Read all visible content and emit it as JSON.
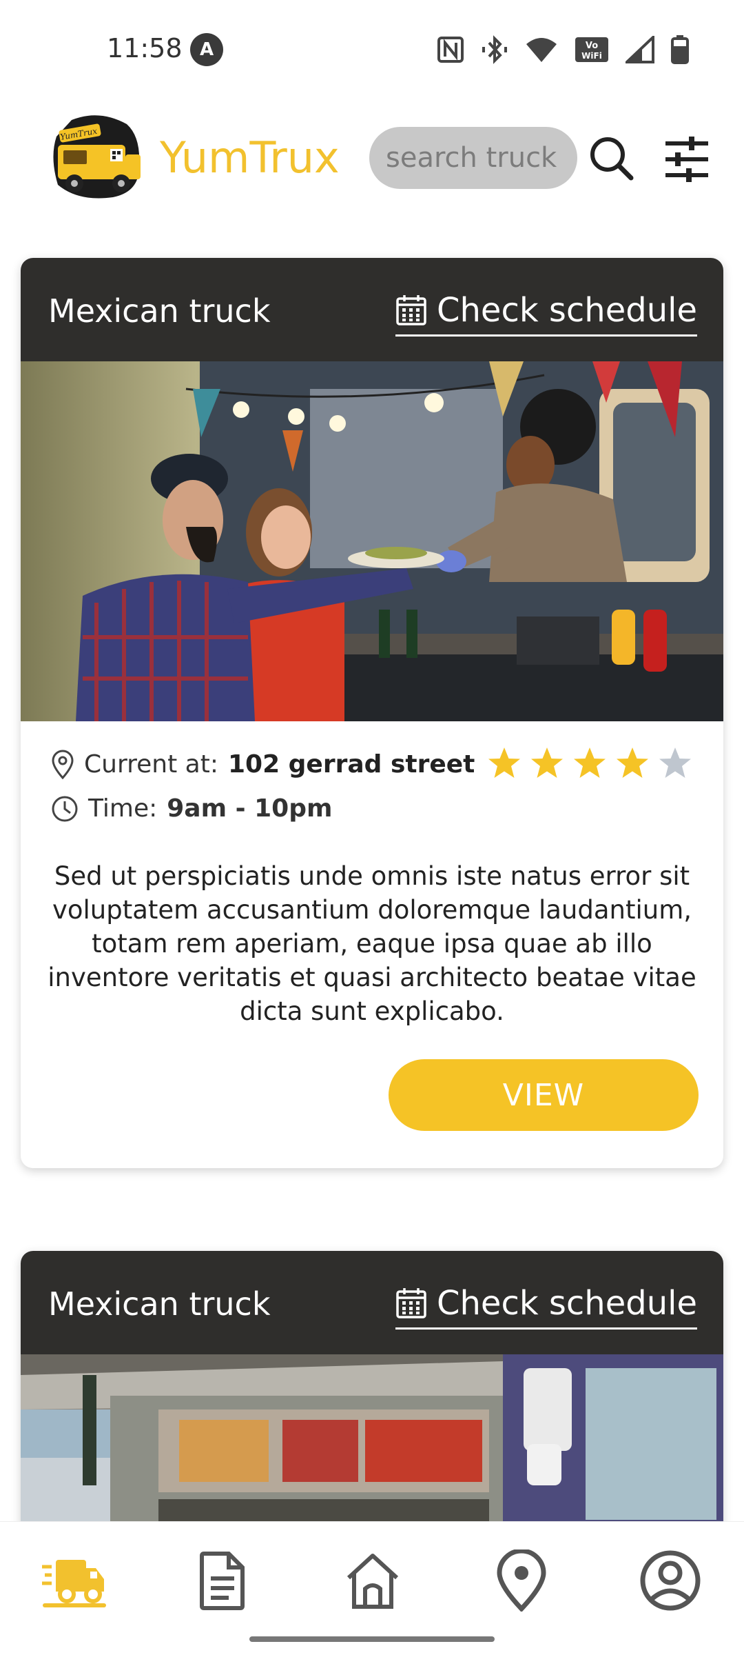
{
  "status_bar": {
    "time": "11:58",
    "badge": "A",
    "icons": [
      "nfc-icon",
      "bluetooth-vibrate-icon",
      "wifi-icon",
      "vowifi-icon",
      "cell-signal-icon",
      "battery-icon"
    ],
    "vowifi_label": "VoWiFi"
  },
  "header": {
    "brand": "YumTrux",
    "logo_text": "YumTrux",
    "search_placeholder": "search truck",
    "accent_color": "#F2C12E"
  },
  "cards": [
    {
      "title": "Mexican truck",
      "schedule_label": "Check schedule",
      "location_label": "Current at:",
      "location_value": "102 gerrad street",
      "time_label": "Time:",
      "time_value": "9am - 10pm",
      "rating": 4,
      "rating_max": 5,
      "description": "Sed ut perspiciatis unde omnis iste natus error sit voluptatem accusantium doloremque laudantium, totam rem aperiam, eaque ipsa quae ab illo inventore veritatis et quasi architecto beatae vitae dicta sunt explicabo.",
      "view_label": "VIEW"
    },
    {
      "title": "Mexican truck",
      "schedule_label": "Check schedule"
    }
  ],
  "bottom_nav": {
    "items": [
      "truck-icon",
      "document-icon",
      "home-icon",
      "location-pin-icon",
      "account-icon"
    ],
    "active": "truck-icon"
  }
}
